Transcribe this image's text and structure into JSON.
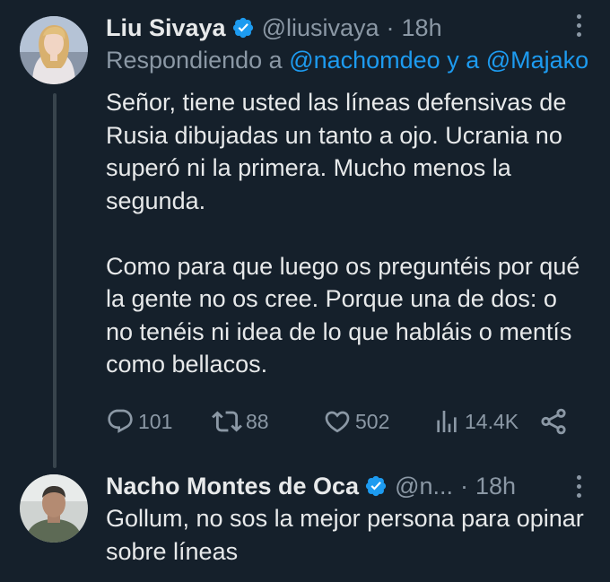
{
  "tweet1": {
    "author_name": "Liu Sivaya",
    "handle": "@liusivaya",
    "separator": "·",
    "time": "18h",
    "reply_prefix": "Respondiendo a",
    "reply_mention": "@nachomdeo y a @Majako",
    "paragraph1": "Señor, tiene usted las líneas defensivas de Rusia dibujadas un tanto a ojo. Ucrania no superó ni la primera. Mucho menos la segunda.",
    "paragraph2": "Como para que luego os preguntéis por qué la gente no os cree. Porque una de dos: o no tenéis ni idea de lo que habláis o mentís como bellacos.",
    "replies": "101",
    "retweets": "88",
    "likes": "502",
    "views": "14.4K"
  },
  "tweet2": {
    "author_name": "Nacho Montes de Oca",
    "handle": "@n...",
    "separator": "·",
    "time": "18h",
    "text": "Gollum, no sos la mejor persona para opinar sobre líneas"
  },
  "icons": {
    "verified": "verified-badge-icon",
    "more": "more-options-icon",
    "reply": "reply-icon",
    "retweet": "retweet-icon",
    "like": "heart-icon",
    "views": "views-icon",
    "share": "share-icon"
  },
  "colors": {
    "background": "#15202b",
    "text": "#e7e9ea",
    "secondary": "#8b98a5",
    "accent": "#1d9bf0",
    "thread_line": "#38444d"
  }
}
